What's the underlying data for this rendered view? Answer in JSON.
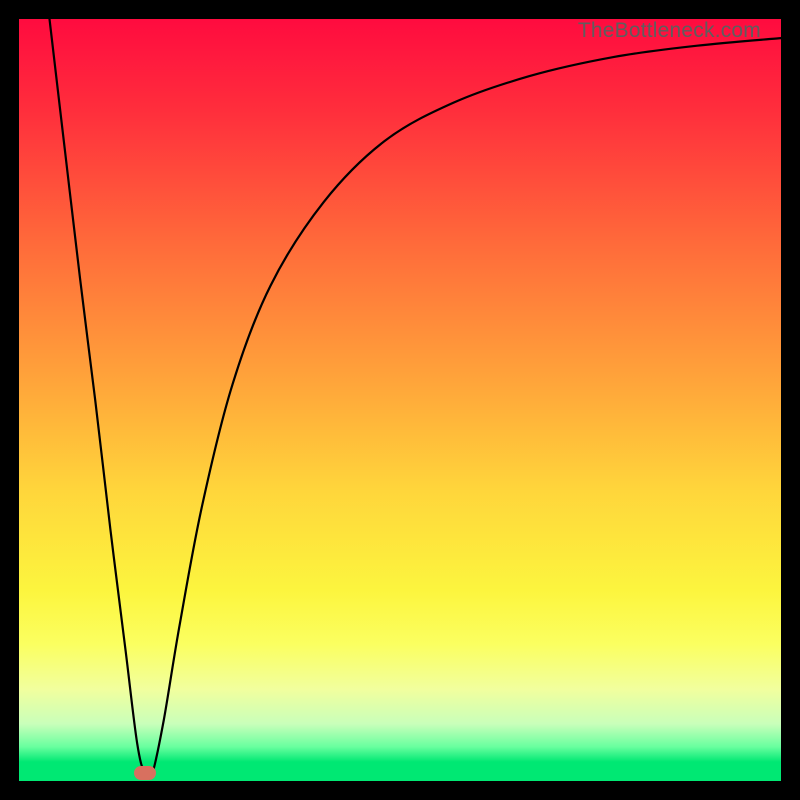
{
  "watermark": {
    "text": "TheBottleneck.com"
  },
  "chart_data": {
    "type": "line",
    "title": "",
    "xlabel": "",
    "ylabel": "",
    "xlim": [
      0,
      100
    ],
    "ylim": [
      0,
      100
    ],
    "grid": false,
    "legend": false,
    "series": [
      {
        "name": "bottleneck-curve",
        "x": [
          4,
          6,
          8,
          10,
          12,
          14,
          15.5,
          16.5,
          17.5,
          19,
          21,
          24,
          28,
          33,
          40,
          48,
          57,
          67,
          78,
          89,
          100
        ],
        "values": [
          100,
          83,
          66,
          50,
          33,
          17,
          5,
          1,
          1,
          8,
          20,
          36,
          52,
          65,
          76,
          84,
          89,
          92.5,
          95,
          96.5,
          97.5
        ]
      }
    ],
    "gradient_stops": [
      {
        "pos": 0.0,
        "color": "#ff0b3f"
      },
      {
        "pos": 0.12,
        "color": "#ff2e3c"
      },
      {
        "pos": 0.3,
        "color": "#ff6c3a"
      },
      {
        "pos": 0.48,
        "color": "#ffa63a"
      },
      {
        "pos": 0.62,
        "color": "#ffd63b"
      },
      {
        "pos": 0.75,
        "color": "#fcf53e"
      },
      {
        "pos": 0.82,
        "color": "#fbff60"
      },
      {
        "pos": 0.88,
        "color": "#f1ff9e"
      },
      {
        "pos": 0.925,
        "color": "#c9ffba"
      },
      {
        "pos": 0.955,
        "color": "#69ff9f"
      },
      {
        "pos": 0.975,
        "color": "#00e873"
      },
      {
        "pos": 1.0,
        "color": "#00e873"
      }
    ],
    "marker": {
      "x": 16.5,
      "y": 1,
      "color": "#d8705f"
    }
  }
}
